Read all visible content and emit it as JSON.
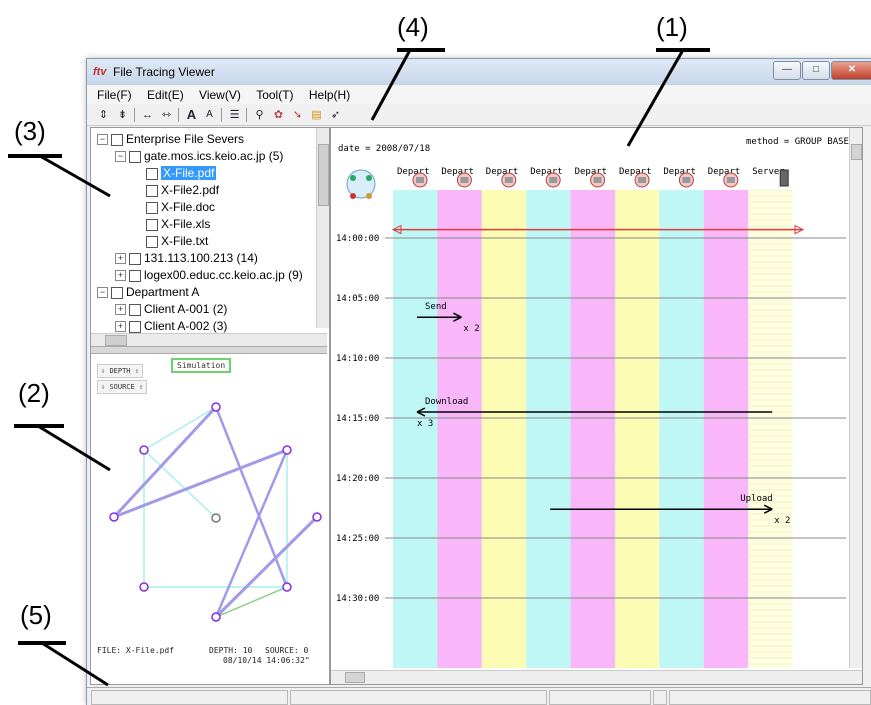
{
  "callouts": [
    "(1)",
    "(2)",
    "(3)",
    "(4)",
    "(5)"
  ],
  "window": {
    "title": "File Tracing Viewer",
    "app_icon": "ftv-app-icon",
    "buttons": {
      "minimize": "—",
      "maximize": "□",
      "close": "✕"
    }
  },
  "menu": [
    "File(F)",
    "Edit(E)",
    "View(V)",
    "Tool(T)",
    "Help(H)"
  ],
  "toolbar": {
    "icons": [
      "expand-vertical-icon",
      "collapse-vertical-icon",
      "expand-horizontal-icon",
      "collapse-horizontal-icon",
      "font-larger-icon",
      "font-smaller-icon",
      "list-icon",
      "binoculars-icon",
      "filter-icon",
      "trace-icon",
      "open-folder-icon",
      "pointer-icon"
    ],
    "glyphs": [
      "⇕",
      "⇟",
      "↔",
      "⇿",
      "A",
      "A",
      "☰",
      "⚲",
      "✿",
      "➘",
      "▤",
      "➶"
    ]
  },
  "tree": [
    {
      "level": 0,
      "toggle": "−",
      "label": "Enterprise File Severs"
    },
    {
      "level": 1,
      "toggle": "−",
      "label": "gate.mos.ics.keio.ac.jp (5)"
    },
    {
      "level": 2,
      "toggle": "",
      "label": "X-File.pdf",
      "selected": true
    },
    {
      "level": 2,
      "toggle": "",
      "label": "X-File2.pdf"
    },
    {
      "level": 2,
      "toggle": "",
      "label": "X-File.doc"
    },
    {
      "level": 2,
      "toggle": "",
      "label": "X-File.xls"
    },
    {
      "level": 2,
      "toggle": "",
      "label": "X-File.txt"
    },
    {
      "level": 1,
      "toggle": "+",
      "label": "131.113.100.213 (14)"
    },
    {
      "level": 1,
      "toggle": "+",
      "label": "logex00.educ.cc.keio.ac.jp (9)"
    },
    {
      "level": 0,
      "toggle": "−",
      "label": "Department A"
    },
    {
      "level": 1,
      "toggle": "+",
      "label": "Client A-001 (2)"
    },
    {
      "level": 1,
      "toggle": "+",
      "label": "Client A-002 (3)"
    }
  ],
  "graph": {
    "depth_label": "DEPTH",
    "source_label": "SOURCE",
    "simulation_label": "Simulation",
    "footer_file": "FILE: X-File.pdf",
    "footer_depth": "DEPTH: 10",
    "footer_source": "SOURCE: 0",
    "footer_datetime": "08/10/14 14:06:32\""
  },
  "timeline": {
    "date": "date = 2008/07/18",
    "method": "method = GROUP BASED",
    "columns": [
      "Depart",
      "Depart",
      "Depart",
      "Depart",
      "Depart",
      "Depart",
      "Depart",
      "Depart",
      "Server"
    ],
    "column_colors": [
      "#bff6f6",
      "#f9b7f9",
      "#fdfcb4",
      "#bff6f6",
      "#f9b7f9",
      "#fdfcb4",
      "#bff6f6",
      "#f9b7f9",
      "#fdfde0"
    ],
    "times": [
      "14:00:00",
      "14:05:00",
      "14:10:00",
      "14:15:00",
      "14:20:00",
      "14:25:00",
      "14:30:00"
    ],
    "events": [
      {
        "label": "Send",
        "count": "x 2",
        "from_col": 0,
        "to_col": 1,
        "time_min": 6.6
      },
      {
        "label": "Download",
        "count": "x 3",
        "from_col": 8,
        "to_col": 0,
        "time_min": 14.5
      },
      {
        "label": "Upload",
        "count": "x 2",
        "from_col": 3,
        "to_col": 8,
        "time_min": 22.6
      }
    ],
    "marker_time_min": -0.7
  },
  "status": {
    "fields": [
      "",
      "",
      "",
      "",
      ""
    ]
  }
}
